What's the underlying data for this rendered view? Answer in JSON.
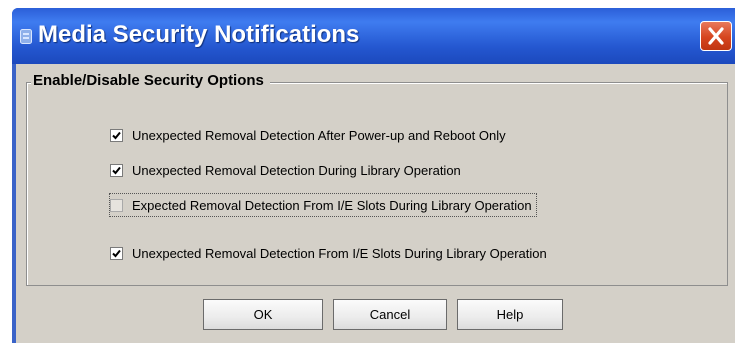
{
  "window": {
    "title": "Media Security Notifications"
  },
  "group": {
    "legend": "Enable/Disable Security Options"
  },
  "options": [
    {
      "label": "Unexpected Removal Detection After Power-up and Reboot Only",
      "checked": true
    },
    {
      "label": "Unexpected Removal Detection During Library Operation",
      "checked": true
    },
    {
      "label": "Expected Removal Detection From I/E Slots During Library Operation",
      "checked": false
    },
    {
      "label": "Unexpected Removal Detection From I/E Slots During Library Operation",
      "checked": true
    }
  ],
  "buttons": {
    "ok": "OK",
    "cancel": "Cancel",
    "help": "Help"
  },
  "icons": {
    "app": "app-icon",
    "close": "close-icon",
    "check": "checkmark-icon"
  },
  "colors": {
    "titlebar": "#2457d0",
    "close": "#d6451f",
    "dialog_bg": "#d4d0c8"
  }
}
